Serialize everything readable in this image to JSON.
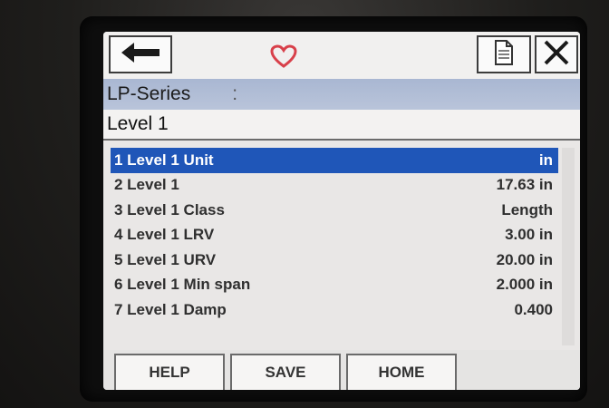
{
  "toolbar": {
    "back_icon": "back-arrow-icon",
    "status_icon": "heart-icon",
    "status_color": "#d8404a",
    "doc_icon": "document-icon",
    "close_icon": "close-icon"
  },
  "header": {
    "device_name": "LP-Series",
    "separator": ":",
    "page_title": "Level 1"
  },
  "menu": {
    "items": [
      {
        "label": "1 Level 1 Unit",
        "value": "in",
        "selected": true
      },
      {
        "label": "2 Level 1",
        "value": "17.63 in",
        "selected": false
      },
      {
        "label": "3 Level 1 Class",
        "value": "Length",
        "selected": false
      },
      {
        "label": "4 Level 1 LRV",
        "value": "3.00 in",
        "selected": false
      },
      {
        "label": "5 Level 1 URV",
        "value": "20.00 in",
        "selected": false
      },
      {
        "label": "6 Level 1 Min span",
        "value": "2.000 in",
        "selected": false
      },
      {
        "label": "7 Level 1 Damp",
        "value": "0.400",
        "selected": false
      }
    ],
    "selection_color": "#1f56b8"
  },
  "footer": {
    "help_label": "HELP",
    "save_label": "SAVE",
    "home_label": "HOME"
  }
}
